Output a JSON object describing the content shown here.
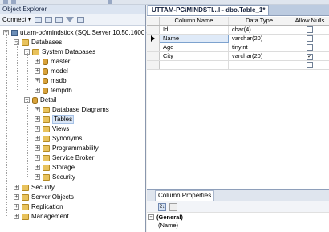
{
  "object_explorer": {
    "title": "Object Explorer",
    "toolbar": {
      "connect_label": "Connect ▾"
    },
    "tree": [
      {
        "label": "uttam-pc\\mindstick (SQL Server 10.50.1600 -",
        "expander": "−",
        "icon": "server-icon"
      },
      {
        "label": "Databases",
        "expander": "−",
        "icon": "folder-icon"
      },
      {
        "label": "System Databases",
        "expander": "−",
        "icon": "folder-icon"
      },
      {
        "label": "master",
        "expander": "+",
        "icon": "database-icon"
      },
      {
        "label": "model",
        "expander": "+",
        "icon": "database-icon"
      },
      {
        "label": "msdb",
        "expander": "+",
        "icon": "database-icon"
      },
      {
        "label": "tempdb",
        "expander": "+",
        "icon": "database-icon"
      },
      {
        "label": "Detail",
        "expander": "−",
        "icon": "database-icon"
      },
      {
        "label": "Database Diagrams",
        "expander": "+",
        "icon": "folder-icon"
      },
      {
        "label": "Tables",
        "expander": "+",
        "icon": "folder-icon"
      },
      {
        "label": "Views",
        "expander": "+",
        "icon": "folder-icon"
      },
      {
        "label": "Synonyms",
        "expander": "+",
        "icon": "folder-icon"
      },
      {
        "label": "Programmability",
        "expander": "+",
        "icon": "folder-icon"
      },
      {
        "label": "Service Broker",
        "expander": "+",
        "icon": "folder-icon"
      },
      {
        "label": "Storage",
        "expander": "+",
        "icon": "folder-icon"
      },
      {
        "label": "Security",
        "expander": "+",
        "icon": "folder-icon"
      },
      {
        "label": "Security",
        "expander": "+",
        "icon": "folder-icon"
      },
      {
        "label": "Server Objects",
        "expander": "+",
        "icon": "folder-icon"
      },
      {
        "label": "Replication",
        "expander": "+",
        "icon": "folder-icon"
      },
      {
        "label": "Management",
        "expander": "+",
        "icon": "folder-icon"
      }
    ]
  },
  "document": {
    "tab_label": "UTTAM-PC\\MINDSTI...l - dbo.Table_1*"
  },
  "table_designer": {
    "headers": {
      "column_name": "Column Name",
      "data_type": "Data Type",
      "allow_nulls": "Allow Nulls"
    },
    "rows": [
      {
        "name": "Id",
        "type": "char(4)",
        "allow_nulls": false
      },
      {
        "name": "Name",
        "type": "varchar(20)",
        "allow_nulls": false
      },
      {
        "name": "Age",
        "type": "tinyint",
        "allow_nulls": false
      },
      {
        "name": "City",
        "type": "varchar(20)",
        "allow_nulls": true
      },
      {
        "name": "",
        "type": "",
        "allow_nulls": false
      }
    ]
  },
  "column_properties": {
    "tab_label": "Column Properties",
    "sort_label": "2↓",
    "sections": [
      {
        "label": "(General)",
        "expander": "−"
      },
      {
        "label": "(Name)",
        "expander": ""
      }
    ]
  }
}
